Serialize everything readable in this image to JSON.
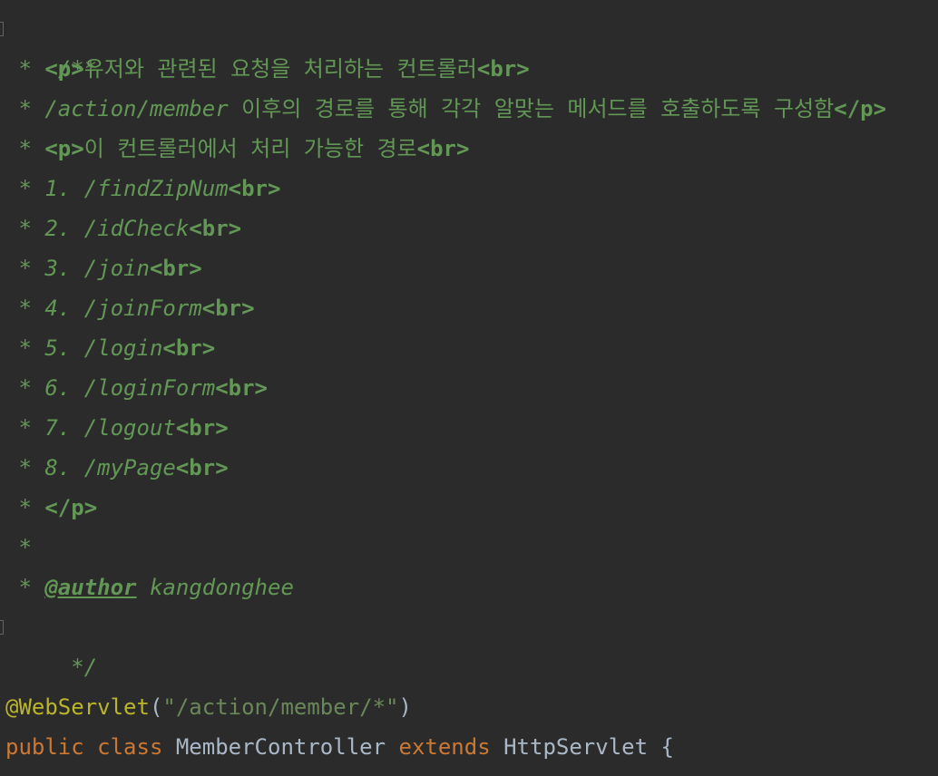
{
  "editor": {
    "comment": {
      "open": "/**",
      "star": " * ",
      "lines": [
        {
          "parts": [
            {
              "t": "tag",
              "v": "<p>"
            },
            {
              "t": "kr",
              "v": "유저와 관련된 요청을 처리하는 컨트롤러"
            },
            {
              "t": "tag",
              "v": "<br>"
            }
          ]
        },
        {
          "parts": [
            {
              "t": "doc",
              "v": "/action/member "
            },
            {
              "t": "kr",
              "v": "이후의 경로를 통해 각각 알맞는 메서드를 호출하도록 구성함"
            },
            {
              "t": "tag",
              "v": "</p>"
            }
          ]
        },
        {
          "parts": [
            {
              "t": "tag",
              "v": "<p>"
            },
            {
              "t": "kr",
              "v": "이 컨트롤러에서 처리 가능한 경로"
            },
            {
              "t": "tag",
              "v": "<br>"
            }
          ]
        },
        {
          "parts": [
            {
              "t": "doc",
              "v": "1. /findZipNum"
            },
            {
              "t": "tag",
              "v": "<br>"
            }
          ]
        },
        {
          "parts": [
            {
              "t": "doc",
              "v": "2. /idCheck"
            },
            {
              "t": "tag",
              "v": "<br>"
            }
          ]
        },
        {
          "parts": [
            {
              "t": "doc",
              "v": "3. /join"
            },
            {
              "t": "tag",
              "v": "<br>"
            }
          ]
        },
        {
          "parts": [
            {
              "t": "doc",
              "v": "4. /joinForm"
            },
            {
              "t": "tag",
              "v": "<br>"
            }
          ]
        },
        {
          "parts": [
            {
              "t": "doc",
              "v": "5. /login"
            },
            {
              "t": "tag",
              "v": "<br>"
            }
          ]
        },
        {
          "parts": [
            {
              "t": "doc",
              "v": "6. /loginForm"
            },
            {
              "t": "tag",
              "v": "<br>"
            }
          ]
        },
        {
          "parts": [
            {
              "t": "doc",
              "v": "7. /logout"
            },
            {
              "t": "tag",
              "v": "<br>"
            }
          ]
        },
        {
          "parts": [
            {
              "t": "doc",
              "v": "8. /myPage"
            },
            {
              "t": "tag",
              "v": "<br>"
            }
          ]
        },
        {
          "parts": [
            {
              "t": "tag",
              "v": "</p>"
            }
          ]
        },
        {
          "parts": []
        },
        {
          "parts": [
            {
              "t": "doctag",
              "v": "@author"
            },
            {
              "t": "doc",
              "v": " kangdonghee"
            }
          ]
        }
      ],
      "close": " */"
    },
    "annotation": {
      "name": "@WebServlet",
      "open_paren": "(",
      "value": "\"/action/member/*\"",
      "close_paren": ")"
    },
    "declaration": {
      "kw_public": "public",
      "kw_class": "class",
      "class_name": "MemberController",
      "kw_extends": "extends",
      "parent": "HttpServlet",
      "brace": "{"
    }
  }
}
